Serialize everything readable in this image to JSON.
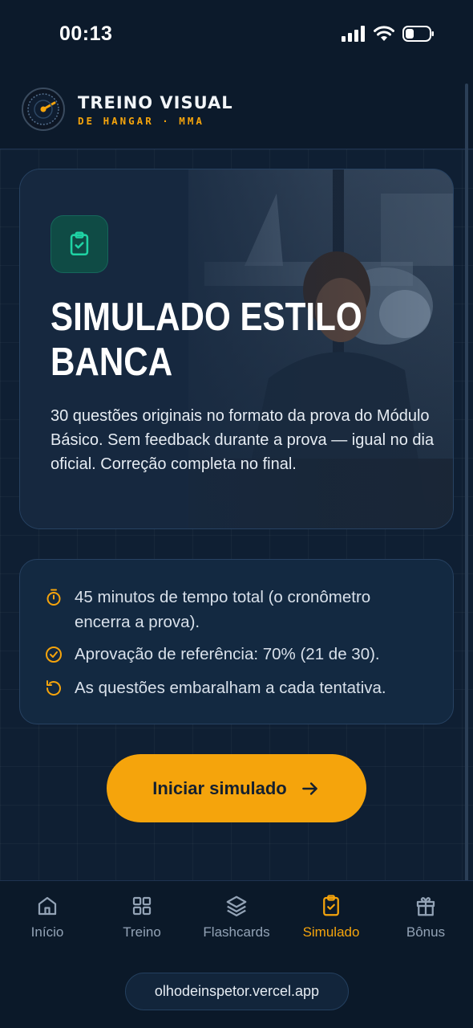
{
  "status_bar": {
    "time": "00:13"
  },
  "brand": {
    "title": "TREINO VISUAL",
    "subtitle": "DE HANGAR · MMA"
  },
  "hero": {
    "title": "SIMULADO ESTILO BANCA",
    "description": "30 questões originais no formato da prova do Módulo Básico. Sem feedback durante a prova — igual no dia oficial. Correção completa no final."
  },
  "info": {
    "items": [
      {
        "icon": "timer-icon",
        "text": "45 minutos de tempo total (o cronômetro encerra a prova)."
      },
      {
        "icon": "check-circle-icon",
        "text": "Aprovação de referência: 70% (21 de 30)."
      },
      {
        "icon": "rotate-icon",
        "text": "As questões embaralham a cada tentativa."
      }
    ]
  },
  "cta": {
    "label": "Iniciar simulado"
  },
  "nav": {
    "items": [
      {
        "label": "Início",
        "icon": "home-icon"
      },
      {
        "label": "Treino",
        "icon": "grid-icon"
      },
      {
        "label": "Flashcards",
        "icon": "layers-icon"
      },
      {
        "label": "Simulado",
        "icon": "clipboard-check-icon",
        "active": true
      },
      {
        "label": "Bônus",
        "icon": "gift-icon"
      }
    ]
  },
  "url_bar": {
    "url": "olhodeinspetor.vercel.app"
  },
  "colors": {
    "accent": "#f5a40c",
    "background": "#0c1a2b",
    "card": "#132941",
    "teal": "#1fd3a4"
  }
}
